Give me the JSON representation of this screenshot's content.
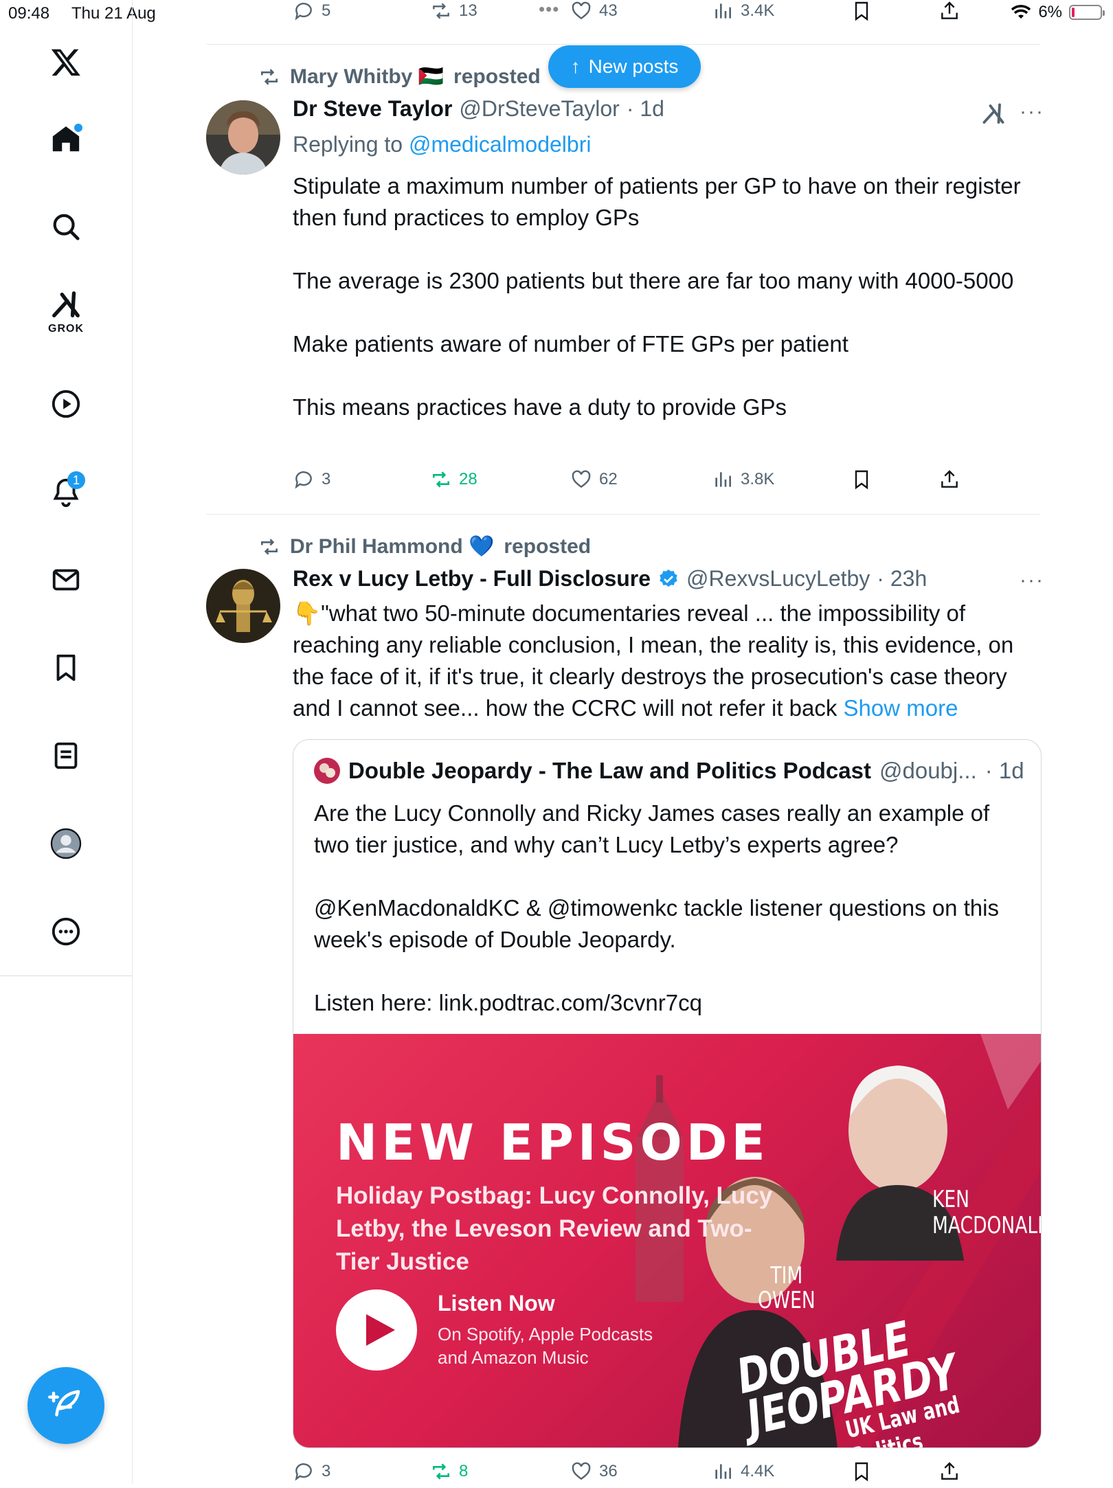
{
  "status_bar": {
    "time": "09:48",
    "date": "Thu 21 Aug",
    "battery": "6%",
    "dots": "•••"
  },
  "nav": {
    "grok_label": "GROK",
    "notifications_badge": "1"
  },
  "new_posts_label": "New posts",
  "top_actions": {
    "replies": "5",
    "reposts": "13",
    "likes": "43",
    "views": "3.4K"
  },
  "tweet1": {
    "reposted_by": "Mary Whitby 🇵🇸",
    "reposted_word": "reposted",
    "name": "Dr Steve Taylor",
    "handle": "@DrSteveTaylor",
    "time": "· 1d",
    "replying_prefix": "Replying to",
    "replying_to": "@medicalmodelbri",
    "text": "Stipulate a maximum number of patients per GP to have on their register then fund practices to employ GPs\n\nThe average is 2300 patients but there are far too many with 4000-5000\n\nMake patients aware of number of FTE GPs per patient\n\nThis means practices have a duty to provide GPs",
    "actions": {
      "replies": "3",
      "reposts": "28",
      "likes": "62",
      "views": "3.8K"
    }
  },
  "tweet2": {
    "reposted_by": "Dr Phil Hammond 💙",
    "reposted_word": "reposted",
    "name": "Rex v Lucy Letby - Full Disclosure",
    "handle": "@RexvsLucyLetby",
    "time": "· 23h",
    "text": "👇\"what two 50-minute documentaries reveal ... the impossibility of reaching any reliable conclusion, I mean, the reality is, this evidence, on the face of it, if it's true, it clearly destroys the prosecution's case theory and I cannot see... how the CCRC will not refer it back ",
    "show_more": "Show more",
    "quote": {
      "name": "Double Jeopardy - The Law and Politics Podcast",
      "handle": "@doubj...",
      "time": "· 1d",
      "text": "Are the Lucy Connolly and Ricky James cases really an example of two tier justice, and why can’t Lucy Letby’s experts agree?\n\n@KenMacdonaldKC & @timowenkc tackle listener questions on this week's episode of Double Jeopardy.\n\nListen here: link.podtrac.com/3cvnr7cq",
      "image": {
        "headline": "NEW EPISODE",
        "subtitle": "Holiday Postbag: Lucy Connolly, Lucy Letby, the Leveson Review and Two-Tier Justice",
        "cta": "Listen Now",
        "platforms": "On Spotify, Apple Podcasts and Amazon Music",
        "host1": "KEN\nMACDONALD",
        "host2": "TIM\nOWEN",
        "brand": "DOUBLE\nJEOPARDY",
        "brand_sub": "UK Law and Politics"
      }
    },
    "actions": {
      "replies": "3",
      "reposts": "8",
      "likes": "36",
      "views": "4.4K"
    }
  },
  "colors": {
    "accent": "#1d9bf0",
    "repost_green": "#00ba7c",
    "muted": "#536471",
    "promo": "#e0305a"
  }
}
